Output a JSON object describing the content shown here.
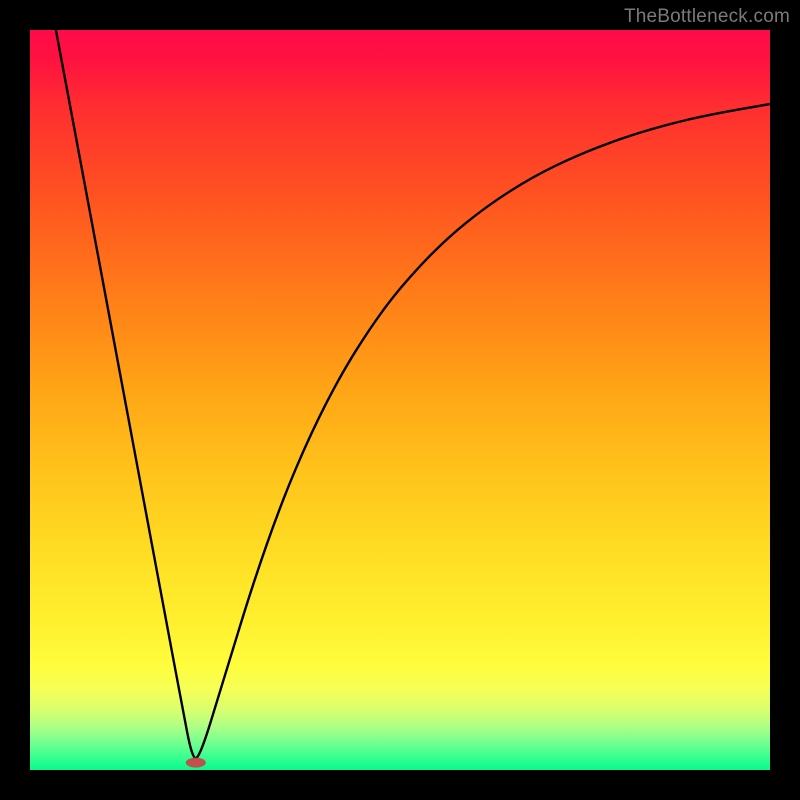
{
  "watermark": {
    "text": "TheBottleneck.com"
  },
  "colors": {
    "frame": "#000000",
    "curve": "#000000",
    "marker": "#c0504d",
    "gradient_top": "#ff0b49",
    "gradient_bottom": "#07f98c"
  },
  "chart_data": {
    "type": "line",
    "title": "",
    "xlabel": "",
    "ylabel": "",
    "xlim": [
      0,
      1
    ],
    "ylim": [
      0,
      1
    ],
    "grid": false,
    "legend": false,
    "annotations": [],
    "series": [
      {
        "name": "left-branch",
        "x": [
          0.035,
          0.06,
          0.085,
          0.11,
          0.135,
          0.16,
          0.185,
          0.205,
          0.219
        ],
        "y": [
          1.0,
          0.866,
          0.732,
          0.598,
          0.464,
          0.33,
          0.196,
          0.09,
          0.016
        ]
      },
      {
        "name": "right-branch",
        "x": [
          0.229,
          0.26,
          0.3,
          0.34,
          0.38,
          0.42,
          0.46,
          0.5,
          0.56,
          0.62,
          0.68,
          0.74,
          0.8,
          0.86,
          0.92,
          1.0
        ],
        "y": [
          0.016,
          0.116,
          0.248,
          0.362,
          0.456,
          0.534,
          0.598,
          0.652,
          0.716,
          0.764,
          0.802,
          0.831,
          0.854,
          0.872,
          0.886,
          0.9
        ]
      }
    ],
    "minimum_point": {
      "x": 0.224,
      "y": 0.01
    }
  }
}
